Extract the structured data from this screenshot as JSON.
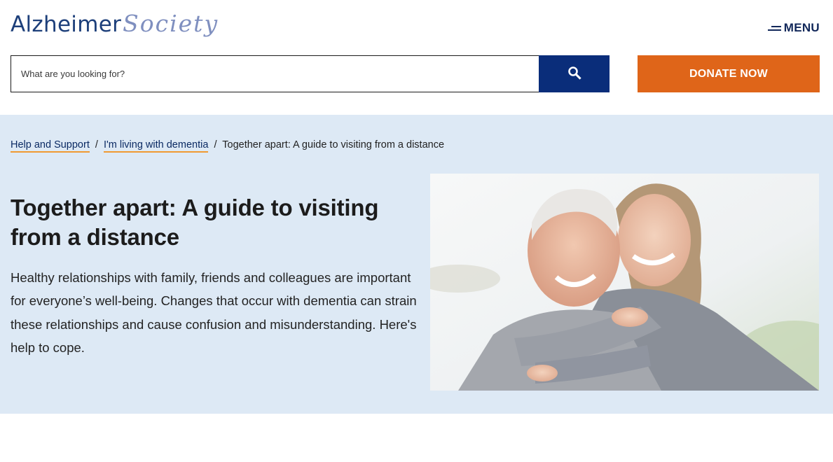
{
  "header": {
    "logo": {
      "word1": "Alzheimer",
      "word2": "Society"
    },
    "menu_label": "MENU",
    "search": {
      "placeholder": "What are you looking for?",
      "value": ""
    },
    "search_icon": "search-icon",
    "donate_label": "DONATE NOW"
  },
  "breadcrumb": {
    "items": [
      {
        "label": "Help and Support"
      },
      {
        "label": "I'm living with dementia"
      }
    ],
    "separator": "/",
    "current": "Together apart: A guide to visiting from a distance"
  },
  "hero": {
    "title": "Together apart: A guide to visiting from a distance",
    "description": "Healthy relationships with family, friends and colleagues are important for everyone’s well-being. Changes that occur with dementia can strain these relationships and cause confusion and misunderstanding. Here's help to cope.",
    "image_subject": "older-man-hugged-by-smiling-woman-photo"
  },
  "colors": {
    "brand_navy": "#1d3f7a",
    "search_button": "#0a2d7a",
    "donate": "#df6519",
    "hero_background": "#dde9f5",
    "breadcrumb_underline": "#f09a32"
  }
}
